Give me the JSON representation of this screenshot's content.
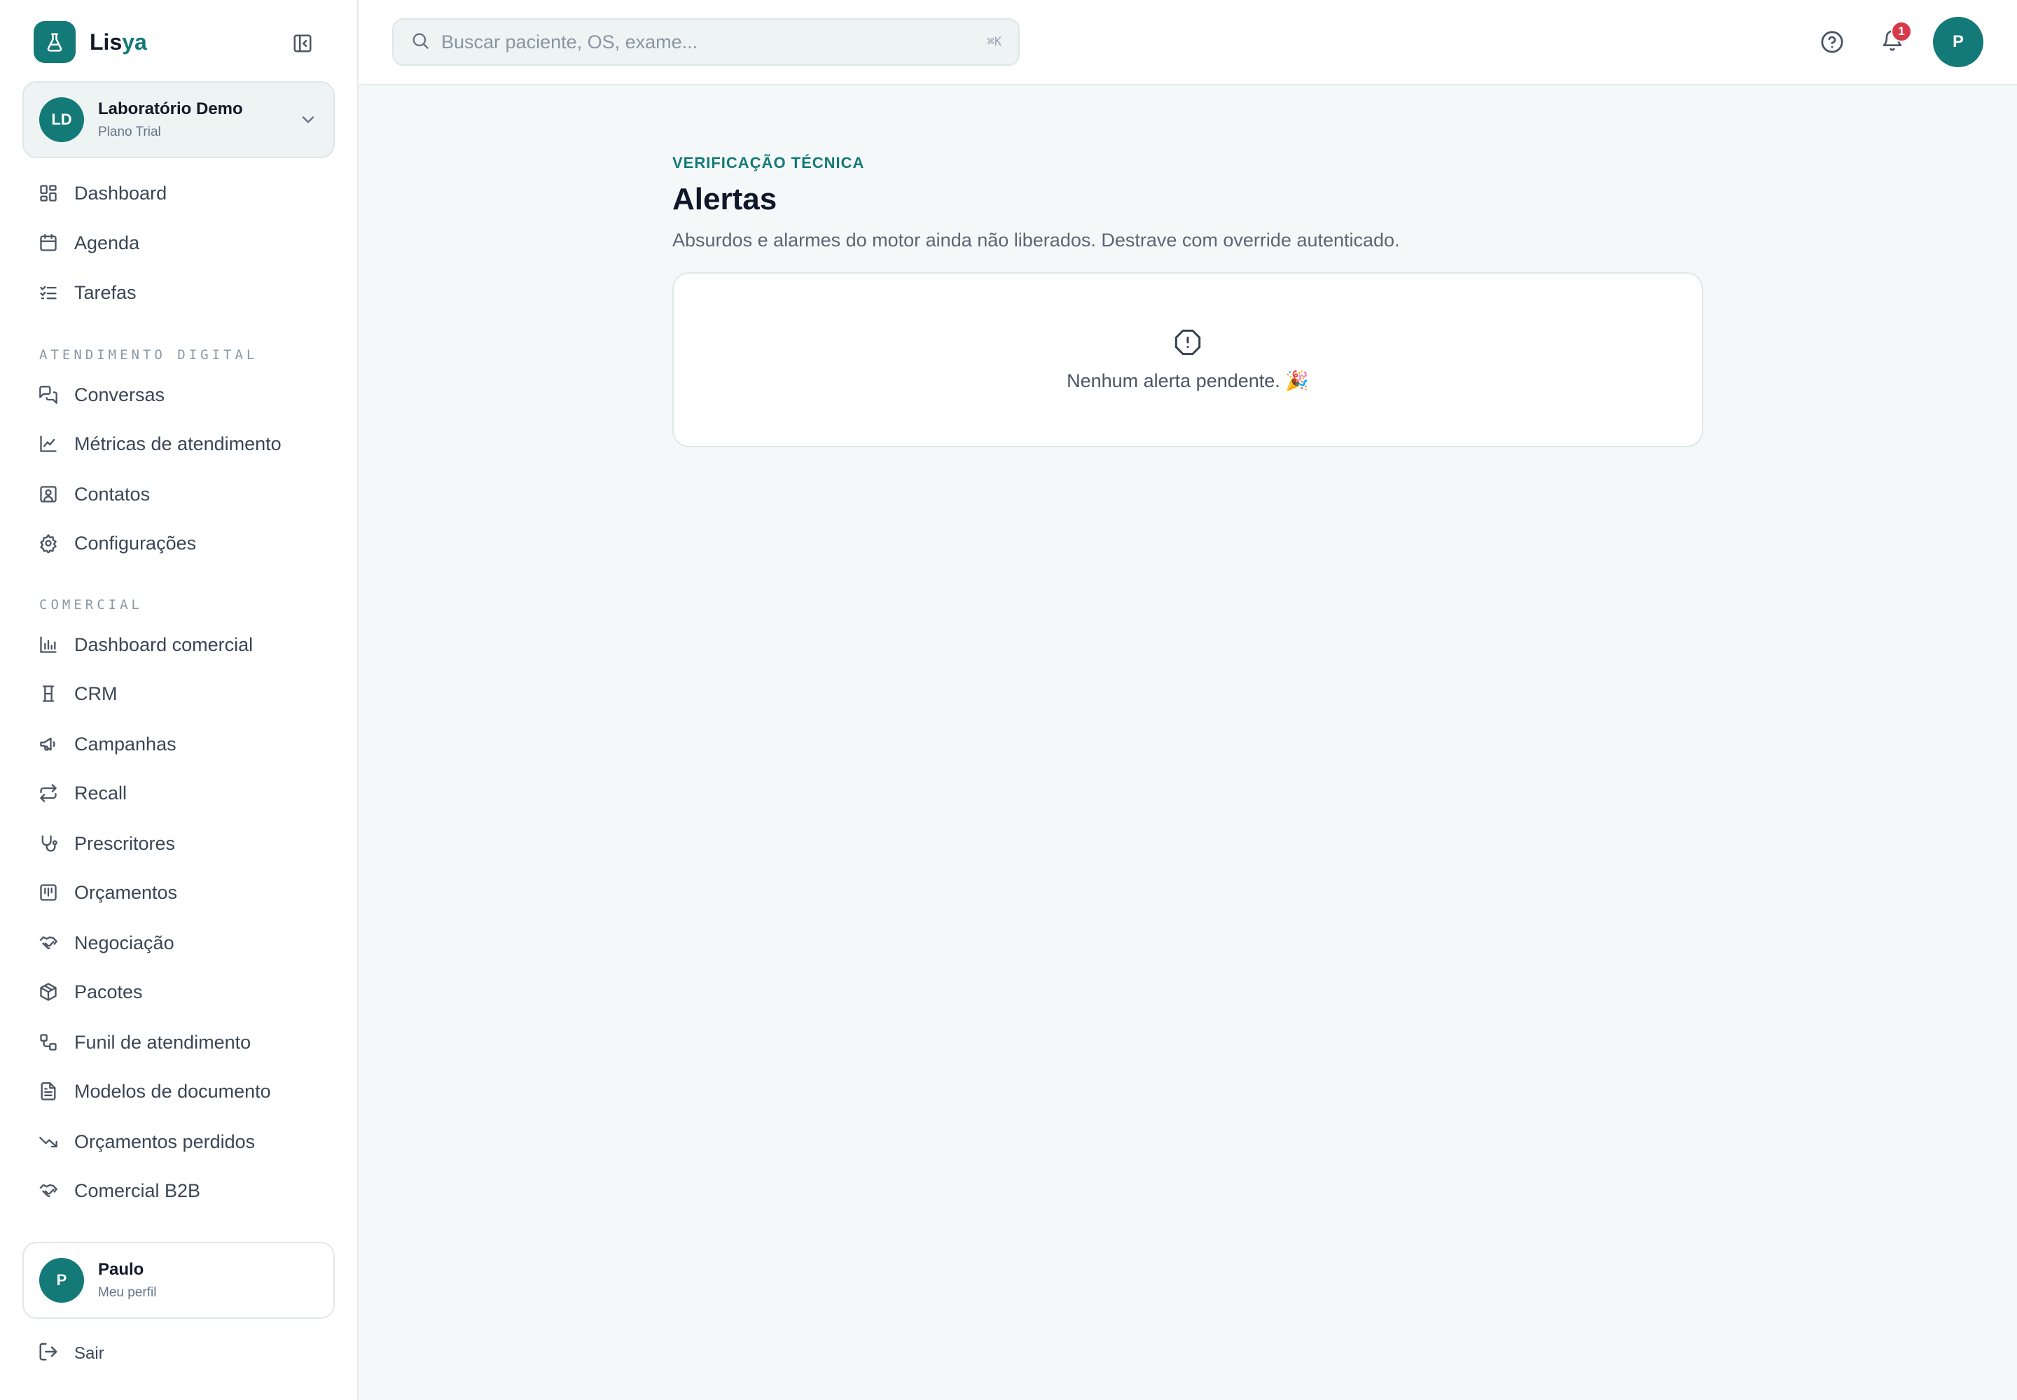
{
  "brand": {
    "name_prefix": "Lis",
    "name_accent": "ya"
  },
  "organization": {
    "initials": "LD",
    "name": "Laboratório Demo",
    "plan": "Plano Trial"
  },
  "nav": {
    "primary": [
      {
        "label": "Dashboard",
        "icon": "dashboard-icon"
      },
      {
        "label": "Agenda",
        "icon": "calendar-icon"
      },
      {
        "label": "Tarefas",
        "icon": "tasks-icon"
      }
    ],
    "sections": [
      {
        "title": "ATENDIMENTO DIGITAL",
        "items": [
          {
            "label": "Conversas",
            "icon": "chat-icon"
          },
          {
            "label": "Métricas de atendimento",
            "icon": "line-chart-icon"
          },
          {
            "label": "Contatos",
            "icon": "contacts-icon"
          },
          {
            "label": "Configurações",
            "icon": "gear-icon"
          }
        ]
      },
      {
        "title": "COMERCIAL",
        "items": [
          {
            "label": "Dashboard comercial",
            "icon": "bar-chart-icon"
          },
          {
            "label": "CRM",
            "icon": "crm-icon"
          },
          {
            "label": "Campanhas",
            "icon": "megaphone-icon"
          },
          {
            "label": "Recall",
            "icon": "repeat-icon"
          },
          {
            "label": "Prescritores",
            "icon": "stethoscope-icon"
          },
          {
            "label": "Orçamentos",
            "icon": "receipt-icon"
          },
          {
            "label": "Negociação",
            "icon": "handshake-icon"
          },
          {
            "label": "Pacotes",
            "icon": "package-icon"
          },
          {
            "label": "Funil de atendimento",
            "icon": "workflow-icon"
          },
          {
            "label": "Modelos de documento",
            "icon": "document-icon"
          },
          {
            "label": "Orçamentos perdidos",
            "icon": "trend-down-icon"
          },
          {
            "label": "Comercial B2B",
            "icon": "handshake-icon"
          }
        ]
      }
    ]
  },
  "profile": {
    "initial": "P",
    "name": "Paulo",
    "subtitle": "Meu perfil"
  },
  "logout_label": "Sair",
  "search": {
    "placeholder": "Buscar paciente, OS, exame...",
    "shortcut": "⌘K"
  },
  "topbar": {
    "notifications_count": "1",
    "user_initial": "P"
  },
  "page": {
    "eyebrow": "VERIFICAÇÃO TÉCNICA",
    "title": "Alertas",
    "description": "Absurdos e alarmes do motor ainda não liberados. Destrave com override autenticado.",
    "empty_message": "Nenhum alerta pendente. 🎉"
  },
  "colors": {
    "accent": "#137a78",
    "badge": "#d63a4a",
    "background": "#f5f8f8"
  }
}
